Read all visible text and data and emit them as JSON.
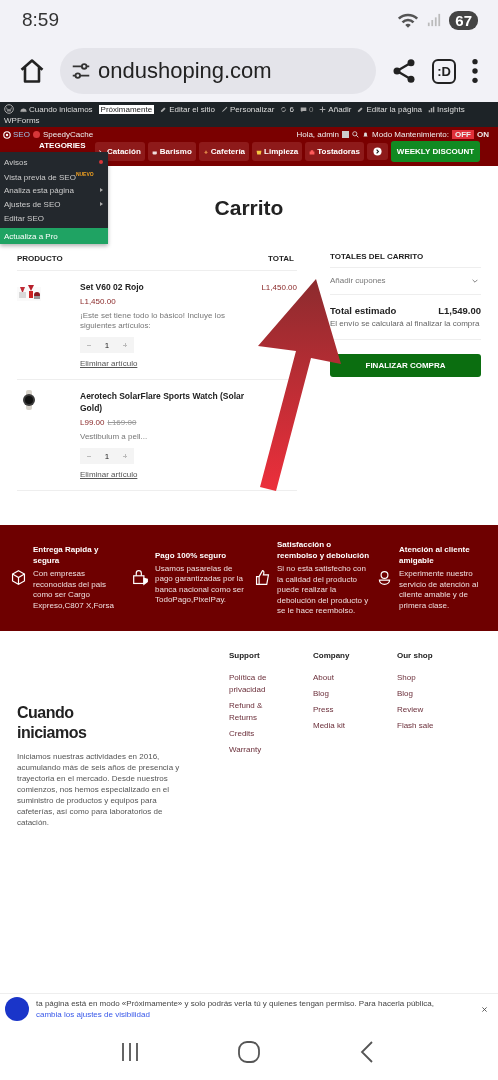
{
  "status_bar": {
    "time": "8:59",
    "battery": "67"
  },
  "browser": {
    "url": "ondushoping.com",
    "tab_count": ":D"
  },
  "admin_bar": {
    "items": [
      {
        "kind": "site",
        "label": "Cuando iniciamos"
      },
      {
        "kind": "badge",
        "label": "Próximamente"
      },
      {
        "kind": "edit-site",
        "label": "Editar el sitio"
      },
      {
        "kind": "customize",
        "label": "Personalizar"
      },
      {
        "kind": "updates",
        "label": "6"
      },
      {
        "kind": "comments",
        "label": "0"
      },
      {
        "kind": "add",
        "label": "Añadir"
      },
      {
        "kind": "edit-page",
        "label": "Editar la página"
      },
      {
        "kind": "insights",
        "label": "Insights"
      },
      {
        "kind": "text",
        "label": "WPForms"
      }
    ]
  },
  "nav": {
    "seo": "SEO",
    "speedycache": "SpeedyCache",
    "categories_label": "ATEGORIES",
    "greeting": "Hola, admin",
    "maintenance": "Modo Mantenimiento:",
    "off": "OFF",
    "on": "ON",
    "maintenance_on": false,
    "categories": [
      {
        "label": "Catación",
        "kind": "tool"
      },
      {
        "label": "Barismo",
        "kind": "cup"
      },
      {
        "label": "Cafetería",
        "kind": "coffee"
      },
      {
        "label": "Limpieza",
        "kind": "bucket"
      },
      {
        "label": "Tostadoras",
        "kind": "roaster"
      }
    ],
    "promo": "WEEKLY DISCOUNT"
  },
  "seo_menu": {
    "items": [
      {
        "label": "Avisos",
        "kind": "alert"
      },
      {
        "label": "Vista previa de SEO",
        "kind": "new",
        "badge": "NUEVO"
      },
      {
        "label": "Analiza esta página",
        "kind": "submenu"
      },
      {
        "label": "Ajustes de SEO",
        "kind": "submenu"
      },
      {
        "label": "Editar SEO",
        "kind": "plain"
      },
      {
        "label": "Actualiza a Pro",
        "kind": "pro"
      }
    ]
  },
  "page_title": "Carrito",
  "cart": {
    "columns": [
      "PRODUCTO",
      "TOTAL"
    ],
    "items": [
      {
        "name": "Set V60 02 Rojo",
        "price": "L1,450.00",
        "description": "¡Este set tiene todo lo básico! Incluye los siguientes artículos:",
        "quantity": "1",
        "remove": "Eliminar artículo",
        "total": "L1,450.00"
      },
      {
        "name": "Aerotech SolarFlare Sports Watch (Solar Gold)",
        "price": "L99.00",
        "old_price": "L169.00",
        "description": "Vestibulum a pell...",
        "quantity": "1",
        "remove": "Eliminar artículo"
      }
    ]
  },
  "totals": {
    "title": "TOTALES DEL CARRITO",
    "coupon": "Añadir cupones",
    "label": "Total estimado",
    "value": "L1,549.00",
    "note": "El envío se calculará al finalizar la compra",
    "checkout": "FINALIZAR COMPRA"
  },
  "features": [
    {
      "title": "Entrega Rapida y segura",
      "text": "Con empresas reconocidas del pais como ser Cargo Expreso,C807 X,Forsa"
    },
    {
      "title": "Pago 100% seguro",
      "text": "Usamos pasarelas de pago garantizadas por la banca nacional como ser TodoPago,PixelPay."
    },
    {
      "title": "Satisfacción o reembolso y debolución",
      "text": "Si no esta satisfecho con la calidad del producto puede realizar la debolución del producto y se le hace reembolso."
    },
    {
      "title": "Atención al cliente amigable",
      "text": "Experimente nuestro servicio de atención al cliente amable y de primera clase."
    }
  ],
  "footer": {
    "brand": "Cuando iniciamos",
    "about": "Iniciamos nuestras actividades en 2016, acumulando más de seis años de presencia y trayectoria en el mercado. Desde nuestros comienzos, nos hemos especializado en el suministro de productos y equipos para cafeterías, así como para laboratorios de catación.",
    "columns": [
      {
        "title": "Support",
        "links": [
          "Política de privacidad",
          "Refund & Returns",
          "Credits",
          "Warranty"
        ]
      },
      {
        "title": "Company",
        "links": [
          "About",
          "Blog",
          "Press",
          "Media kit"
        ]
      },
      {
        "title": "Our shop",
        "links": [
          "Shop",
          "Blog",
          "Review",
          "Flash sale"
        ]
      }
    ]
  },
  "notice": {
    "text": "ta página está en modo «Próximamente» y solo podrás verla tú y quienes tengan permiso. Para hacerla pública, ",
    "link": "cambia los ajustes de visibilidad"
  }
}
